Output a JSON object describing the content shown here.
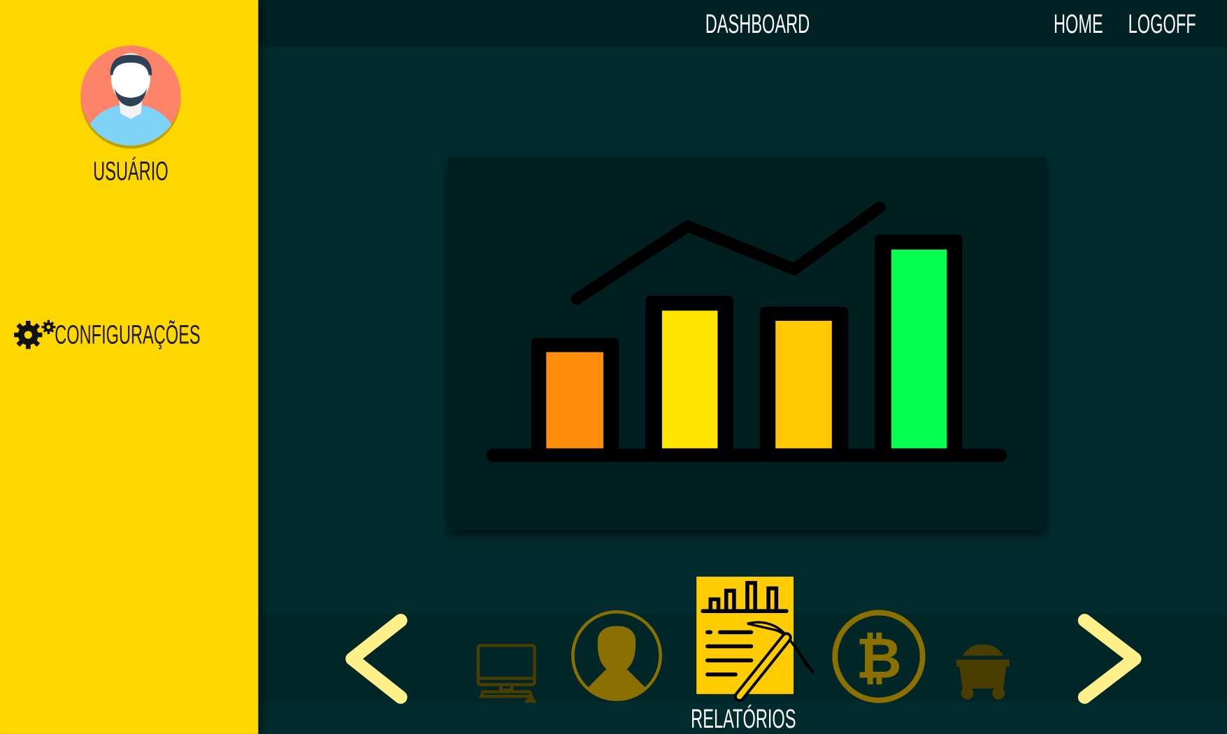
{
  "header": {
    "title": "DASHBOARD",
    "links": [
      {
        "label": "HOME"
      },
      {
        "label": "LOGOFF"
      }
    ]
  },
  "sidebar": {
    "user_name": "USUÁRIO",
    "items": [
      {
        "label": "CONFIGURAÇÕES",
        "icon": "gears-icon"
      }
    ]
  },
  "carousel": {
    "active_label": "RELATÓRIOS",
    "items": [
      {
        "icon": "computer-icon"
      },
      {
        "icon": "user-silhouette-icon"
      },
      {
        "icon": "report-pickaxe-icon",
        "label": "RELATÓRIOS",
        "active": true
      },
      {
        "icon": "bitcoin-icon"
      },
      {
        "icon": "mine-cart-icon"
      }
    ]
  },
  "colors": {
    "sidebar": "#ffd700",
    "background": "#022b2d",
    "accent": "#ffcc00",
    "bar_colors": [
      "#ff8c0a",
      "#ffe500",
      "#ffc800",
      "#05ff4f"
    ]
  }
}
